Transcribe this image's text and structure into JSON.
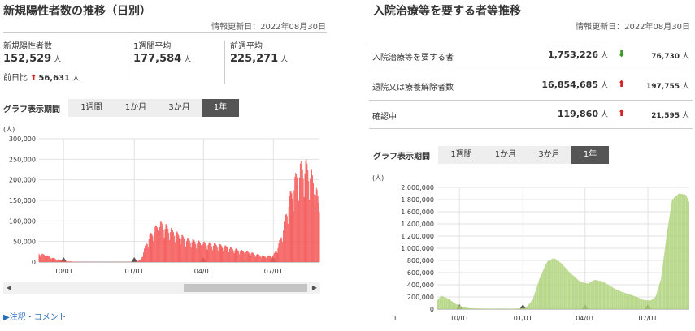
{
  "left": {
    "title": "新規陽性者数の推移（日別）",
    "updated": "情報更新日：2022年08月30日",
    "stats": [
      {
        "label": "新規陽性者数",
        "value": "152,529",
        "unit": "人"
      },
      {
        "label": "1週間平均",
        "value": "177,584",
        "unit": "人"
      },
      {
        "label": "前週平均",
        "value": "225,271",
        "unit": "人"
      }
    ],
    "diff": {
      "label": "前日比",
      "value": "56,631",
      "unit": "人"
    },
    "tabs_label": "グラフ表示期間",
    "tabs": [
      "1週間",
      "1か月",
      "3か月",
      "1年"
    ],
    "active_tab": "1年",
    "note_link": "▶注釈・コメント"
  },
  "right": {
    "title": "入院治療等を要する者等推移",
    "updated": "情報更新日：2022年08月30日",
    "rows": [
      {
        "label": "入院治療等を要する者",
        "value": "1,753,226",
        "unit": "人",
        "direction": "down",
        "diff": "76,730",
        "diff_unit": "人"
      },
      {
        "label": "退院又は療養解除者数",
        "value": "16,854,685",
        "unit": "人",
        "direction": "up",
        "diff": "197,755",
        "diff_unit": "人"
      },
      {
        "label": "確認中",
        "value": "119,860",
        "unit": "人",
        "direction": "up",
        "diff": "21,595",
        "diff_unit": "人"
      }
    ],
    "tabs_label": "グラフ表示期間",
    "tabs": [
      "1週間",
      "1か月",
      "3か月",
      "1年"
    ],
    "active_tab": "1年"
  },
  "colors": {
    "left_series": "#f55a5a",
    "right_series": "#a9d070",
    "up_arrow": "#d22222",
    "down_arrow": "#3a9a28"
  },
  "chart_data": [
    {
      "type": "bar",
      "unit_label": "(人)",
      "x_range": [
        "2021-08-30",
        "2022-08-30"
      ],
      "ylim": [
        0,
        300000
      ],
      "yticks": [
        "0",
        "50,000",
        "100,000",
        "150,000",
        "200,000",
        "250,000",
        "300,000"
      ],
      "xticks": [
        {
          "date": "2021-10-01",
          "label": "10/01"
        },
        {
          "date": "2022-01-01",
          "label": "01/01"
        },
        {
          "date": "2022-04-01",
          "label": "04/01"
        },
        {
          "date": "2022-07-01",
          "label": "07/01"
        }
      ],
      "grid": true,
      "series": [
        {
          "x": [
            "2021-08-30",
            "2021-09-07",
            "2021-09-15",
            "2021-09-25",
            "2021-10-05",
            "2021-10-20",
            "2021-11-15",
            "2021-12-20",
            "2022-01-01",
            "2022-01-05",
            "2022-01-10",
            "2022-01-15",
            "2022-01-20",
            "2022-01-27",
            "2022-02-03",
            "2022-02-10",
            "2022-02-20",
            "2022-03-01",
            "2022-03-10",
            "2022-03-20",
            "2022-04-01",
            "2022-04-10",
            "2022-04-20",
            "2022-05-01",
            "2022-05-10",
            "2022-05-20",
            "2022-06-01",
            "2022-06-10",
            "2022-06-20",
            "2022-07-01",
            "2022-07-07",
            "2022-07-13",
            "2022-07-20",
            "2022-07-27",
            "2022-08-03",
            "2022-08-10",
            "2022-08-17",
            "2022-08-24",
            "2022-08-30"
          ],
          "values": [
            22000,
            19000,
            12000,
            6000,
            2000,
            500,
            200,
            300,
            500,
            2000,
            8000,
            40000,
            65000,
            85000,
            100000,
            95000,
            82000,
            70000,
            60000,
            55000,
            50000,
            48000,
            45000,
            40000,
            35000,
            30000,
            25000,
            20000,
            15000,
            18000,
            40000,
            80000,
            150000,
            200000,
            240000,
            255000,
            245000,
            200000,
            152529
          ]
        }
      ]
    },
    {
      "type": "area",
      "unit_label": "(人)",
      "x_range": [
        "2021-08-30",
        "2022-08-30"
      ],
      "ylim": [
        0,
        2000000
      ],
      "yticks": [
        "0",
        "200,000",
        "400,000",
        "600,000",
        "800,000",
        "1,000,000",
        "1,200,000",
        "1,400,000",
        "1,600,000",
        "1,800,000",
        "2,000,000"
      ],
      "xticks": [
        {
          "date": "2021-10-01",
          "label": "10/01"
        },
        {
          "date": "2022-01-01",
          "label": "01/01"
        },
        {
          "date": "2022-04-01",
          "label": "04/01"
        },
        {
          "date": "2022-07-01",
          "label": "07/01"
        }
      ],
      "extra_xlabel": "1",
      "grid": true,
      "series": [
        {
          "x": [
            "2021-08-30",
            "2021-09-05",
            "2021-09-15",
            "2021-09-25",
            "2021-10-05",
            "2021-10-15",
            "2021-11-01",
            "2021-12-01",
            "2021-12-25",
            "2022-01-05",
            "2022-01-15",
            "2022-01-25",
            "2022-02-05",
            "2022-02-15",
            "2022-02-25",
            "2022-03-10",
            "2022-03-25",
            "2022-04-05",
            "2022-04-15",
            "2022-04-25",
            "2022-05-05",
            "2022-05-15",
            "2022-05-25",
            "2022-06-05",
            "2022-06-15",
            "2022-06-25",
            "2022-07-05",
            "2022-07-12",
            "2022-07-20",
            "2022-07-28",
            "2022-08-05",
            "2022-08-15",
            "2022-08-25",
            "2022-08-30"
          ],
          "values": [
            150000,
            220000,
            170000,
            90000,
            40000,
            15000,
            8000,
            5000,
            8000,
            20000,
            150000,
            500000,
            780000,
            840000,
            760000,
            600000,
            450000,
            420000,
            480000,
            460000,
            400000,
            330000,
            280000,
            240000,
            200000,
            150000,
            140000,
            200000,
            500000,
            1200000,
            1800000,
            1900000,
            1880000,
            1753226
          ]
        }
      ]
    }
  ]
}
